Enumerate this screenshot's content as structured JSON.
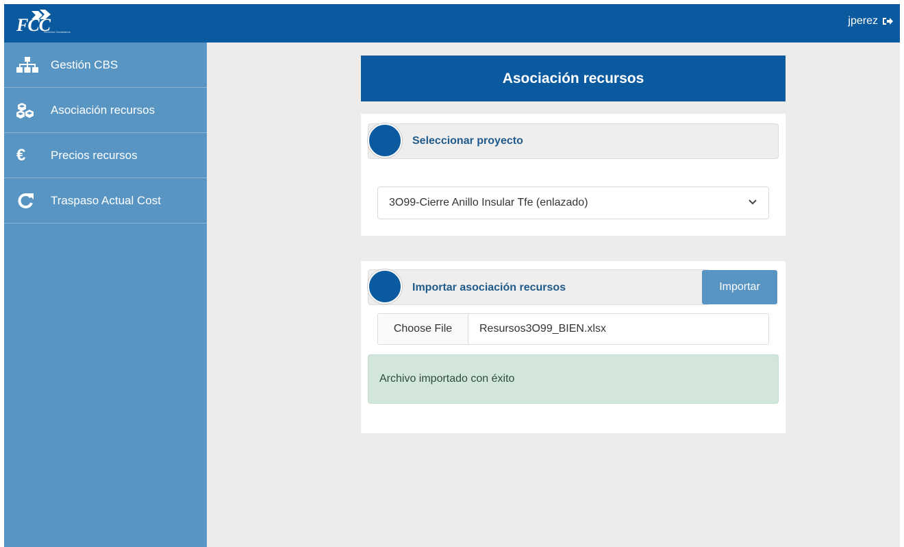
{
  "header": {
    "logo_text": "FCC",
    "logo_subtitle": "Servicios Ciudadanos",
    "user": "jperez",
    "logout_icon": "sign-out-icon"
  },
  "sidebar": {
    "items": [
      {
        "label": "Gestión CBS",
        "icon": "sitemap-icon"
      },
      {
        "label": "Asociación recursos",
        "icon": "cubes-icon"
      },
      {
        "label": "Precios recursos",
        "icon": "euro-icon"
      },
      {
        "label": "Traspaso Actual Cost",
        "icon": "refresh-icon"
      }
    ]
  },
  "main": {
    "title": "Asociación recursos",
    "project_step": {
      "label": "Seleccionar proyecto",
      "selected_project": "3O99-Cierre Anillo Insular Tfe (enlazado)"
    },
    "import_step": {
      "label": "Importar asociación recursos",
      "import_button": "Importar",
      "choose_file_label": "Choose File",
      "file_name": "Resursos3O99_BIEN.xlsx",
      "success_message": "Archivo importado con éxito"
    }
  },
  "colors": {
    "primary": "#0b5a9f",
    "sidebar": "#5895c3",
    "success_bg": "#d3e6dc"
  }
}
